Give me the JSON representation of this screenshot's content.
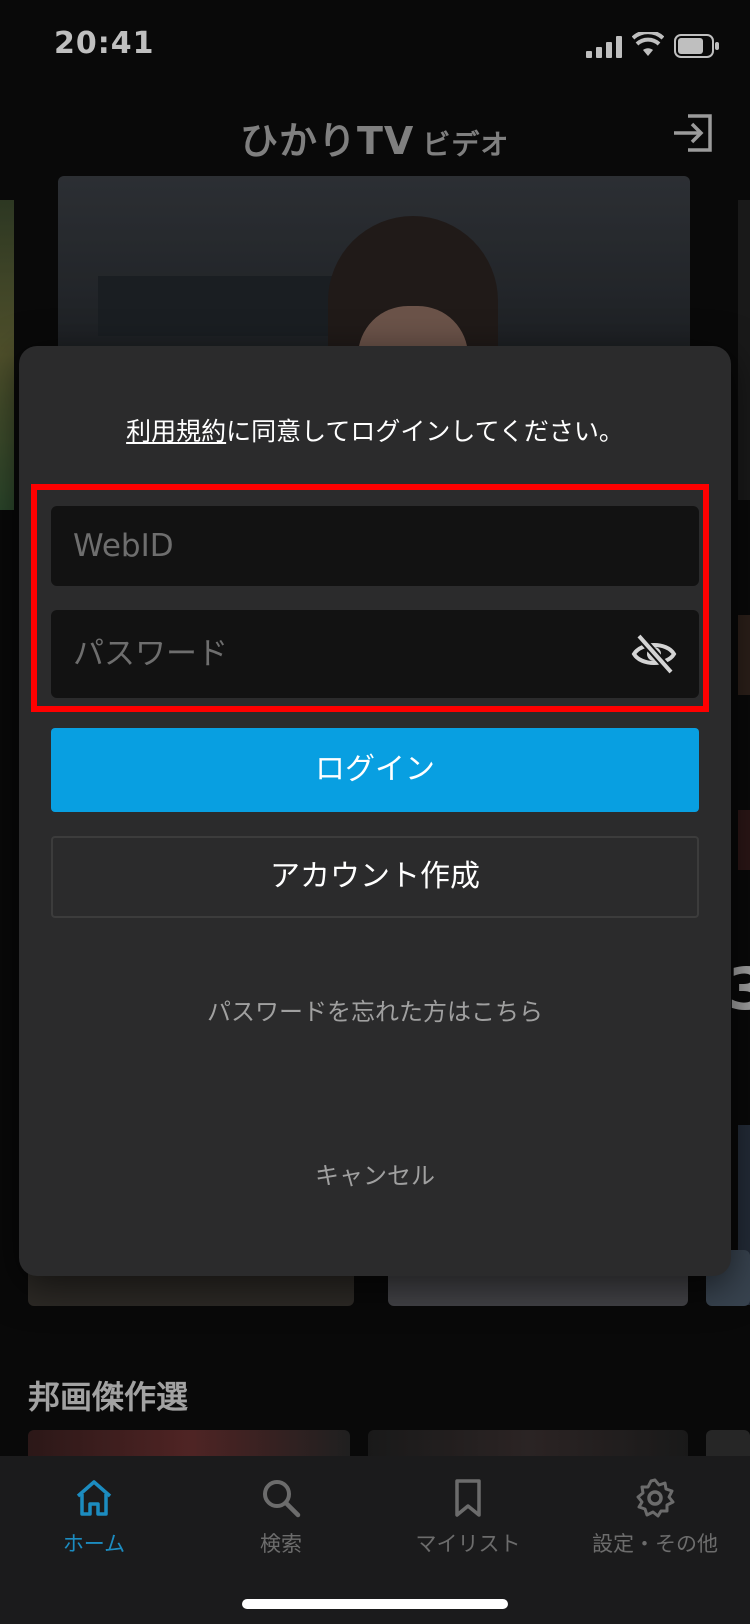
{
  "status_bar": {
    "time": "20:41"
  },
  "header": {
    "logo_main": "ひかりTV",
    "logo_sub": "ビデオ",
    "login_icon": "login-icon"
  },
  "background": {
    "section_title": "邦画傑作選",
    "partial_text": "3"
  },
  "modal": {
    "terms_link": "利用規約",
    "agree_suffix": "に同意してログインしてください。",
    "webid_placeholder": "WebID",
    "password_placeholder": "パスワード",
    "login_button": "ログイン",
    "account_button": "アカウント作成",
    "forgot_link": "パスワードを忘れた方はこちら",
    "cancel": "キャンセル"
  },
  "tab_bar": {
    "tabs": [
      {
        "label": "ホーム",
        "icon": "home-icon",
        "active": true
      },
      {
        "label": "検索",
        "icon": "search-icon",
        "active": false
      },
      {
        "label": "マイリスト",
        "icon": "bookmark-icon",
        "active": false
      },
      {
        "label": "設定・その他",
        "icon": "gear-icon",
        "active": false
      }
    ]
  },
  "colors": {
    "accent": "#089fe1",
    "highlight": "#ff0000",
    "active_tab": "#1c8cc0"
  }
}
